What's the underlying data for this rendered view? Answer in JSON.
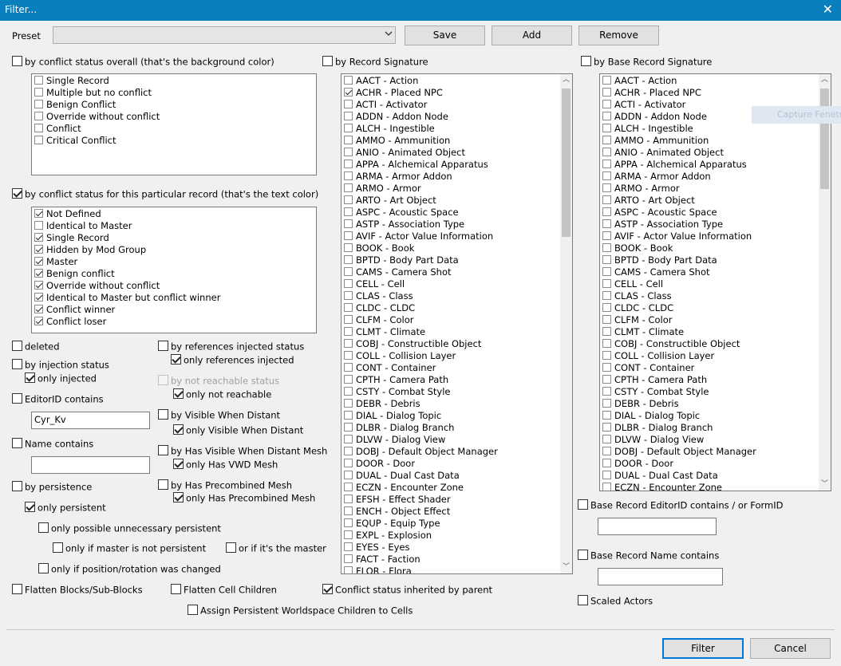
{
  "title": "Filter...",
  "preset": {
    "label": "Preset",
    "value": "",
    "save": "Save",
    "add": "Add",
    "remove": "Remove"
  },
  "conflict_overall": {
    "label": "by conflict status overall (that's the background color)",
    "checked": false,
    "items": [
      {
        "label": "Single Record",
        "checked": false
      },
      {
        "label": "Multiple but no conflict",
        "checked": false
      },
      {
        "label": "Benign Conflict",
        "checked": false
      },
      {
        "label": "Override without conflict",
        "checked": false
      },
      {
        "label": "Conflict",
        "checked": false
      },
      {
        "label": "Critical Conflict",
        "checked": false
      }
    ]
  },
  "conflict_record": {
    "label": "by conflict status for this particular record  (that's the text color)",
    "checked": true,
    "items": [
      {
        "label": "Not Defined",
        "checked": true
      },
      {
        "label": "Identical to Master",
        "checked": false
      },
      {
        "label": "Single Record",
        "checked": true
      },
      {
        "label": "Hidden by Mod Group",
        "checked": true
      },
      {
        "label": "Master",
        "checked": true
      },
      {
        "label": "Benign conflict",
        "checked": true
      },
      {
        "label": "Override without conflict",
        "checked": true
      },
      {
        "label": "Identical to Master but conflict winner",
        "checked": true
      },
      {
        "label": "Conflict winner",
        "checked": true
      },
      {
        "label": "Conflict loser",
        "checked": true
      }
    ]
  },
  "options": {
    "deleted": "deleted",
    "injection": "by injection status",
    "only_injected": "only injected",
    "editorid": "EditorID contains",
    "editorid_value": "Cyr_Kv",
    "name": "Name contains",
    "name_value": "",
    "persistence": "by persistence",
    "only_persistent": "only persistent",
    "only_possible": "only possible unnecessary persistent",
    "only_master_not": "only if master is not persistent",
    "or_master": "or if it's the master",
    "only_position": "only if position/rotation was changed",
    "refs_injected": "by references injected status",
    "only_refs_injected": "only references injected",
    "not_reachable": "by not reachable status",
    "only_not_reachable": "only not reachable",
    "visible_distant": "by Visible When Distant",
    "only_visible_distant": "only Visible When Distant",
    "vwd_mesh": "by Has Visible When Distant Mesh",
    "only_vwd_mesh": "only Has VWD Mesh",
    "precombined": "by Has Precombined Mesh",
    "only_precombined": "only Has Precombined Mesh",
    "flatten_blocks": "Flatten Blocks/Sub-Blocks",
    "flatten_cell": "Flatten Cell Children",
    "conflict_inherited": "Conflict status inherited by parent",
    "assign_persistent": "Assign Persistent Worldspace Children to Cells"
  },
  "record_sig": {
    "label": "by Record Signature",
    "checked": false,
    "items": [
      "AACT - Action",
      "ACHR - Placed NPC",
      "ACTI - Activator",
      "ADDN - Addon Node",
      "ALCH - Ingestible",
      "AMMO - Ammunition",
      "ANIO - Animated Object",
      "APPA - Alchemical Apparatus",
      "ARMA - Armor Addon",
      "ARMO - Armor",
      "ARTO - Art Object",
      "ASPC - Acoustic Space",
      "ASTP - Association Type",
      "AVIF - Actor Value Information",
      "BOOK - Book",
      "BPTD - Body Part Data",
      "CAMS - Camera Shot",
      "CELL - Cell",
      "CLAS - Class",
      "CLDC - CLDC",
      "CLFM - Color",
      "CLMT - Climate",
      "COBJ - Constructible Object",
      "COLL - Collision Layer",
      "CONT - Container",
      "CPTH - Camera Path",
      "CSTY - Combat Style",
      "DEBR - Debris",
      "DIAL - Dialog Topic",
      "DLBR - Dialog Branch",
      "DLVW - Dialog View",
      "DOBJ - Default Object Manager",
      "DOOR - Door",
      "DUAL - Dual Cast Data",
      "ECZN - Encounter Zone",
      "EFSH - Effect Shader",
      "ENCH - Object Effect",
      "EQUP - Equip Type",
      "EXPL - Explosion",
      "EYES - Eyes",
      "FACT - Faction",
      "FLOR - Flora"
    ],
    "checked_index": 1
  },
  "base_sig": {
    "label": "by Base Record Signature",
    "checked": false,
    "items": [
      "AACT - Action",
      "ACHR - Placed NPC",
      "ACTI - Activator",
      "ADDN - Addon Node",
      "ALCH - Ingestible",
      "AMMO - Ammunition",
      "ANIO - Animated Object",
      "APPA - Alchemical Apparatus",
      "ARMA - Armor Addon",
      "ARMO - Armor",
      "ARTO - Art Object",
      "ASPC - Acoustic Space",
      "ASTP - Association Type",
      "AVIF - Actor Value Information",
      "BOOK - Book",
      "BPTD - Body Part Data",
      "CAMS - Camera Shot",
      "CELL - Cell",
      "CLAS - Class",
      "CLDC - CLDC",
      "CLFM - Color",
      "CLMT - Climate",
      "COBJ - Constructible Object",
      "COLL - Collision Layer",
      "CONT - Container",
      "CPTH - Camera Path",
      "CSTY - Combat Style",
      "DEBR - Debris",
      "DIAL - Dialog Topic",
      "DLBR - Dialog Branch",
      "DLVW - Dialog View",
      "DOBJ - Default Object Manager",
      "DOOR - Door",
      "DUAL - Dual Cast Data",
      "ECZN - Encounter Zone"
    ]
  },
  "base_editorid": {
    "label": "Base Record EditorID contains / or FormID",
    "value": ""
  },
  "base_name": {
    "label": "Base Record Name contains",
    "value": ""
  },
  "scaled_actors": "Scaled Actors",
  "ghost_tooltip": "Capture Fenetre",
  "buttons": {
    "filter": "Filter",
    "cancel": "Cancel"
  }
}
